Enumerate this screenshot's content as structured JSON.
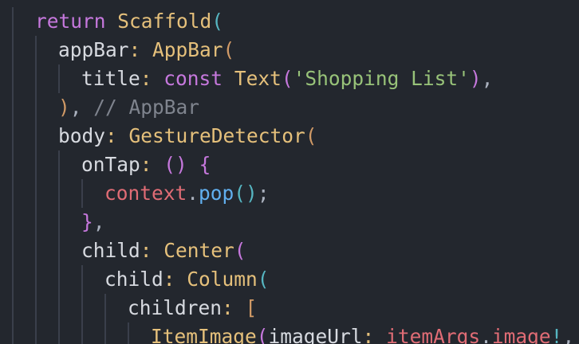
{
  "colors": {
    "background": "#23272e",
    "guide": "#3a3f4b",
    "keyword": "#c678dd",
    "class": "#e5c07b",
    "property": "#d7dae0",
    "punct": "#abb2bf",
    "string": "#98c379",
    "comment": "#7f848e",
    "variable": "#e06c75",
    "method": "#61afef",
    "paren1": "#d19a66",
    "paren2": "#c678dd",
    "paren3": "#56b6c2"
  },
  "code": {
    "lines": [
      {
        "indent": 0,
        "tokens": [
          {
            "t": "return",
            "c": "keyword"
          },
          {
            "t": " ",
            "c": "punct"
          },
          {
            "t": "Scaffold",
            "c": "class"
          },
          {
            "t": "(",
            "c": "paren3"
          }
        ]
      },
      {
        "indent": 1,
        "tokens": [
          {
            "t": "appBar",
            "c": "property"
          },
          {
            "t": ": ",
            "c": "class"
          },
          {
            "t": "AppBar",
            "c": "class"
          },
          {
            "t": "(",
            "c": "paren1"
          }
        ]
      },
      {
        "indent": 2,
        "tokens": [
          {
            "t": "title",
            "c": "property"
          },
          {
            "t": ": ",
            "c": "class"
          },
          {
            "t": "const",
            "c": "keyword"
          },
          {
            "t": " ",
            "c": "punct"
          },
          {
            "t": "Text",
            "c": "class"
          },
          {
            "t": "(",
            "c": "paren2"
          },
          {
            "t": "'Shopping List'",
            "c": "string"
          },
          {
            "t": ")",
            "c": "paren2"
          },
          {
            "t": ",",
            "c": "punct"
          }
        ]
      },
      {
        "indent": 1,
        "tokens": [
          {
            "t": ")",
            "c": "paren1"
          },
          {
            "t": ", ",
            "c": "punct"
          },
          {
            "t": "// AppBar",
            "c": "comment"
          }
        ]
      },
      {
        "indent": 1,
        "tokens": [
          {
            "t": "body",
            "c": "property"
          },
          {
            "t": ": ",
            "c": "class"
          },
          {
            "t": "GestureDetector",
            "c": "class"
          },
          {
            "t": "(",
            "c": "paren1"
          }
        ]
      },
      {
        "indent": 2,
        "tokens": [
          {
            "t": "onTap",
            "c": "property"
          },
          {
            "t": ": ",
            "c": "class"
          },
          {
            "t": "()",
            "c": "paren2"
          },
          {
            "t": " ",
            "c": "punct"
          },
          {
            "t": "{",
            "c": "paren2"
          }
        ]
      },
      {
        "indent": 3,
        "tokens": [
          {
            "t": "context",
            "c": "variable"
          },
          {
            "t": ".",
            "c": "punct"
          },
          {
            "t": "pop",
            "c": "method"
          },
          {
            "t": "()",
            "c": "paren3"
          },
          {
            "t": ";",
            "c": "punct"
          }
        ]
      },
      {
        "indent": 2,
        "tokens": [
          {
            "t": "}",
            "c": "paren2"
          },
          {
            "t": ",",
            "c": "punct"
          }
        ]
      },
      {
        "indent": 2,
        "tokens": [
          {
            "t": "child",
            "c": "property"
          },
          {
            "t": ": ",
            "c": "class"
          },
          {
            "t": "Center",
            "c": "class"
          },
          {
            "t": "(",
            "c": "paren2"
          }
        ]
      },
      {
        "indent": 3,
        "tokens": [
          {
            "t": "child",
            "c": "property"
          },
          {
            "t": ": ",
            "c": "class"
          },
          {
            "t": "Column",
            "c": "class"
          },
          {
            "t": "(",
            "c": "paren3"
          }
        ]
      },
      {
        "indent": 4,
        "tokens": [
          {
            "t": "children",
            "c": "property"
          },
          {
            "t": ": ",
            "c": "class"
          },
          {
            "t": "[",
            "c": "paren1"
          }
        ]
      },
      {
        "indent": 5,
        "tokens": [
          {
            "t": "ItemImage",
            "c": "class"
          },
          {
            "t": "(",
            "c": "paren2"
          },
          {
            "t": "imageUrl",
            "c": "property"
          },
          {
            "t": ": ",
            "c": "class"
          },
          {
            "t": "itemArgs",
            "c": "variable"
          },
          {
            "t": ".",
            "c": "punct"
          },
          {
            "t": "image",
            "c": "variable"
          },
          {
            "t": "!",
            "c": "paren3"
          },
          {
            "t": ", t",
            "c": "punct"
          }
        ]
      }
    ]
  }
}
